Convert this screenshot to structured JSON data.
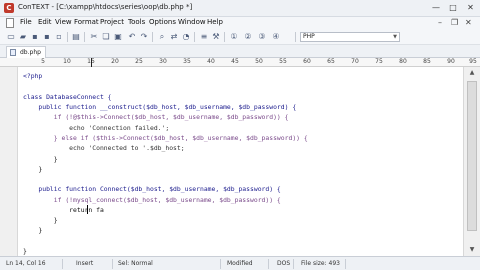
{
  "window": {
    "app_icon": "C",
    "title": "ConTEXT - [C:\\xampp\\htdocs\\series\\oop\\db.php *]",
    "minimize": "—",
    "maximize": "□",
    "close": "✕"
  },
  "menu": {
    "items": [
      "File",
      "Edit",
      "View",
      "Format",
      "Project",
      "Tools",
      "Options",
      "Window",
      "Help"
    ],
    "mdi_min": "–",
    "mdi_restore": "❐",
    "mdi_close": "✕"
  },
  "toolbar": {
    "icons": [
      "new-file-icon",
      "open-folder-icon",
      "save-icon",
      "save-all-icon",
      "close-file-icon",
      "print-icon",
      "cut-icon",
      "copy-icon",
      "paste-icon",
      "undo-icon",
      "redo-icon",
      "find-icon",
      "replace-icon",
      "macro-icon",
      "word-wrap-icon",
      "tools-icon",
      "user-exec-1-icon",
      "user-exec-2-icon",
      "user-exec-3-icon",
      "user-exec-4-icon"
    ],
    "glyphs": [
      "▭",
      "▰",
      "▪",
      "▪",
      "▫",
      "▤",
      "✂",
      "❏",
      "▣",
      "↶",
      "↷",
      "⌕",
      "⇄",
      "◔",
      "≡",
      "⚒",
      "①",
      "②",
      "③",
      "④"
    ],
    "highlighter_value": "PHP"
  },
  "tabs": [
    {
      "label": "db.php"
    }
  ],
  "ruler": {
    "numbers": [
      "5",
      "10",
      "15",
      "20",
      "25",
      "30",
      "35",
      "40",
      "45",
      "50",
      "55",
      "60",
      "65",
      "70",
      "75",
      "80",
      "85",
      "90",
      "95"
    ]
  },
  "code": {
    "line1": "<?php",
    "line2": "",
    "line3": "class DatabaseConnect {",
    "line4": "    public function __construct($db_host, $db_username, $db_password) {",
    "line5": "        if (!@$this->Connect($db_host, $db_username, $db_password)) {",
    "line6": "            echo 'Connection failed.';",
    "line7": "        } else if ($this->Connect($db_host, $db_username, $db_password)) {",
    "line8": "            echo 'Connected to '.$db_host;",
    "line9": "        }",
    "line10": "    }",
    "line11": "",
    "line12": "    public function Connect($db_host, $db_username, $db_password) {",
    "line13": "        if (!mysql_connect($db_host, $db_username, $db_password)) {",
    "line14": "            return fa",
    "line15": "        }",
    "line16": "    }",
    "line17": "",
    "line18": "}"
  },
  "status": {
    "position": "Ln 14, Col 16",
    "mode": "Insert",
    "selection": "Sel: Normal",
    "modified": "Modified",
    "format": "DOS",
    "filesize": "File size: 493"
  }
}
